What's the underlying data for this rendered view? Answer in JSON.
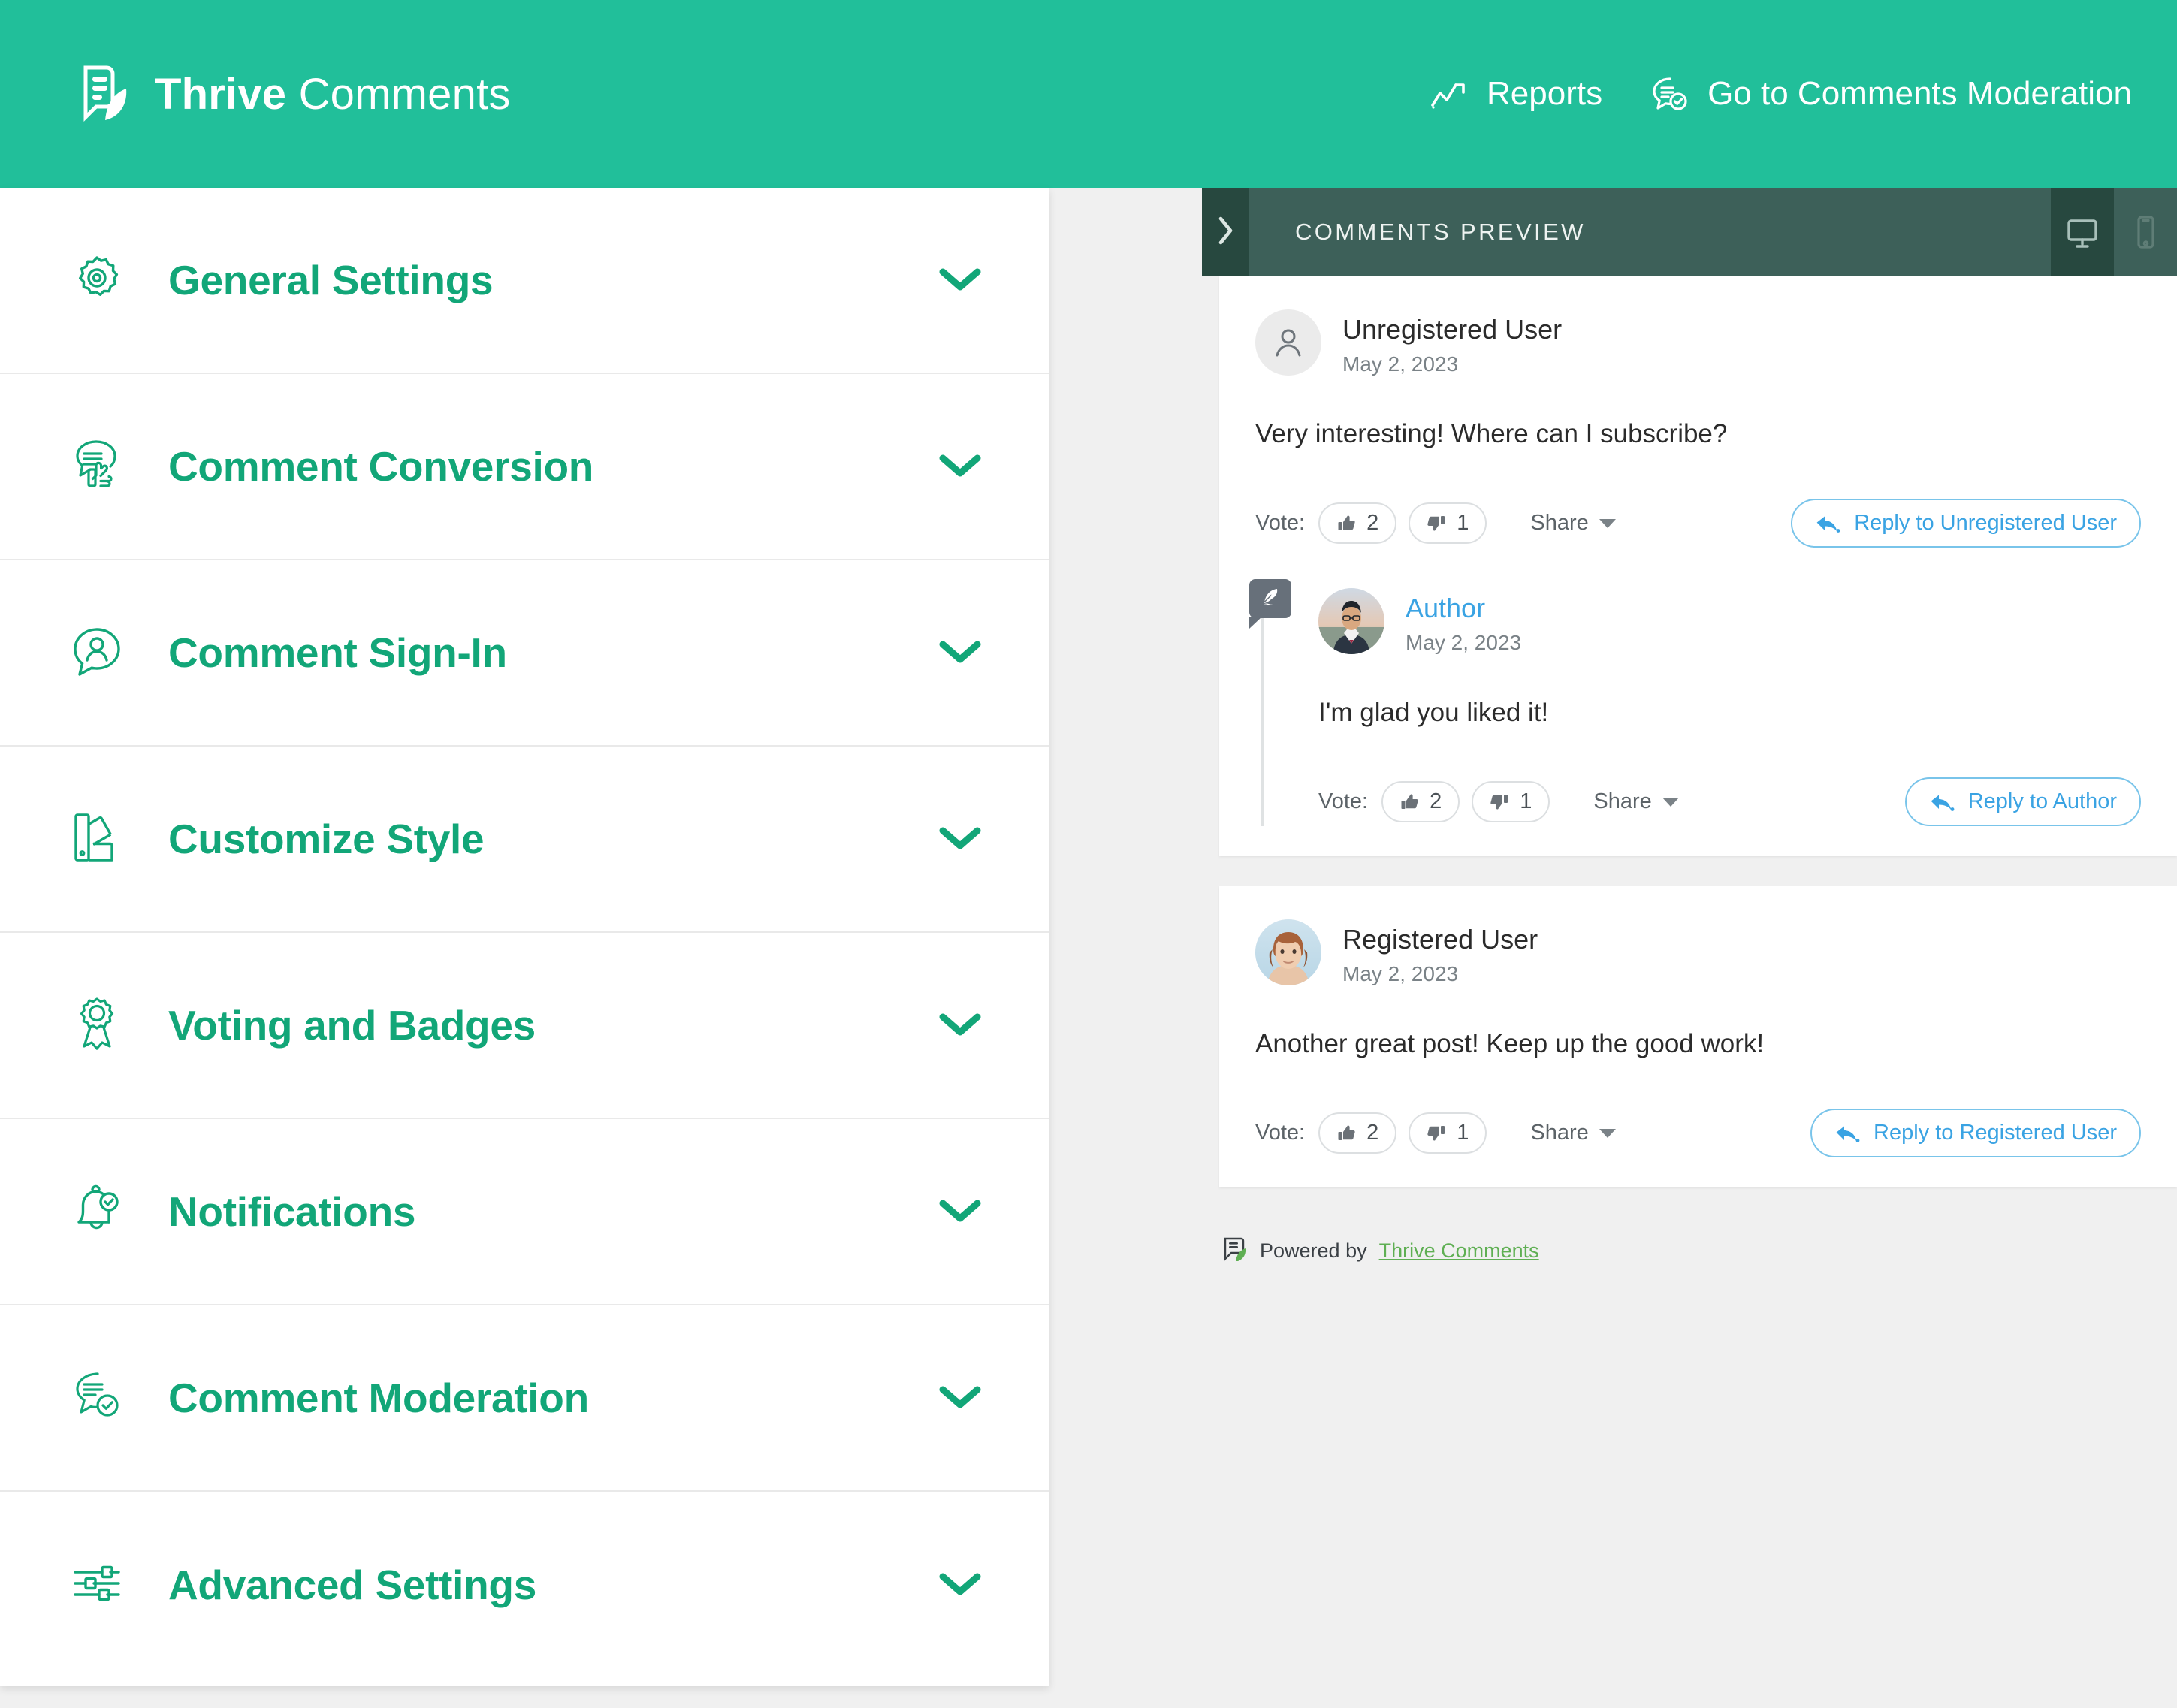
{
  "brand": {
    "name_bold": "Thrive",
    "name_light": "Comments",
    "logo_icon": "thrive-leaf-comment-logo"
  },
  "topnav": [
    {
      "label": "Reports",
      "icon": "analytics-line-chart-icon"
    },
    {
      "label": "Go to Comments Moderation",
      "icon": "comment-check-icon"
    }
  ],
  "sidebar": {
    "items": [
      {
        "label": "General Settings",
        "icon": "gear-icon",
        "chevron": "chevron-down-icon"
      },
      {
        "label": "Comment Conversion",
        "icon": "comment-thumbsup-icon",
        "chevron": "chevron-down-icon"
      },
      {
        "label": "Comment Sign-In",
        "icon": "comment-user-icon",
        "chevron": "chevron-down-icon"
      },
      {
        "label": "Customize Style",
        "icon": "color-swatch-icon",
        "chevron": "chevron-down-icon"
      },
      {
        "label": "Voting and Badges",
        "icon": "award-ribbon-icon",
        "chevron": "chevron-down-icon"
      },
      {
        "label": "Notifications",
        "icon": "bell-check-icon",
        "chevron": "chevron-down-icon"
      },
      {
        "label": "Comment Moderation",
        "icon": "comment-check-icon",
        "chevron": "chevron-down-icon"
      },
      {
        "label": "Advanced Settings",
        "icon": "sliders-icon",
        "chevron": "chevron-down-icon"
      }
    ]
  },
  "preview": {
    "title": "COMMENTS PREVIEW",
    "collapse_icon": "chevron-right-icon",
    "devices": [
      {
        "name": "desktop",
        "icon": "monitor-icon",
        "active": true
      },
      {
        "name": "mobile",
        "icon": "smartphone-icon",
        "active": false
      }
    ],
    "comments": [
      {
        "author": "Unregistered User",
        "date": "May 2, 2023",
        "avatar": "default-person-avatar",
        "body": "Very interesting! Where can I subscribe?",
        "vote_label": "Vote:",
        "upvotes": "2",
        "downvotes": "1",
        "share_label": "Share",
        "reply_label": "Reply to Unregistered User",
        "reply": {
          "author": "Author",
          "date": "May 2, 2023",
          "avatar": "author-photo-avatar",
          "badge_icon": "quill-pen-icon",
          "body": "I'm glad you liked it!",
          "vote_label": "Vote:",
          "upvotes": "2",
          "downvotes": "1",
          "share_label": "Share",
          "reply_label": "Reply to Author"
        }
      },
      {
        "author": "Registered User",
        "date": "May 2, 2023",
        "avatar": "registered-user-photo-avatar",
        "body": "Another great post! Keep up the good work!",
        "vote_label": "Vote:",
        "upvotes": "2",
        "downvotes": "1",
        "share_label": "Share",
        "reply_label": "Reply to Registered User"
      }
    ],
    "footer": {
      "prefix": "Powered by",
      "link": "Thrive Comments",
      "icon": "thrive-leaf-comment-logo"
    }
  },
  "colors": {
    "brand_teal": "#21bf9a",
    "accent_green": "#12a678",
    "preview_header": "#3d6059",
    "preview_header_dark": "#27483f",
    "link_blue": "#3aa3e3",
    "footer_link_green": "#5faf53",
    "page_bg": "#f0f0f0"
  }
}
